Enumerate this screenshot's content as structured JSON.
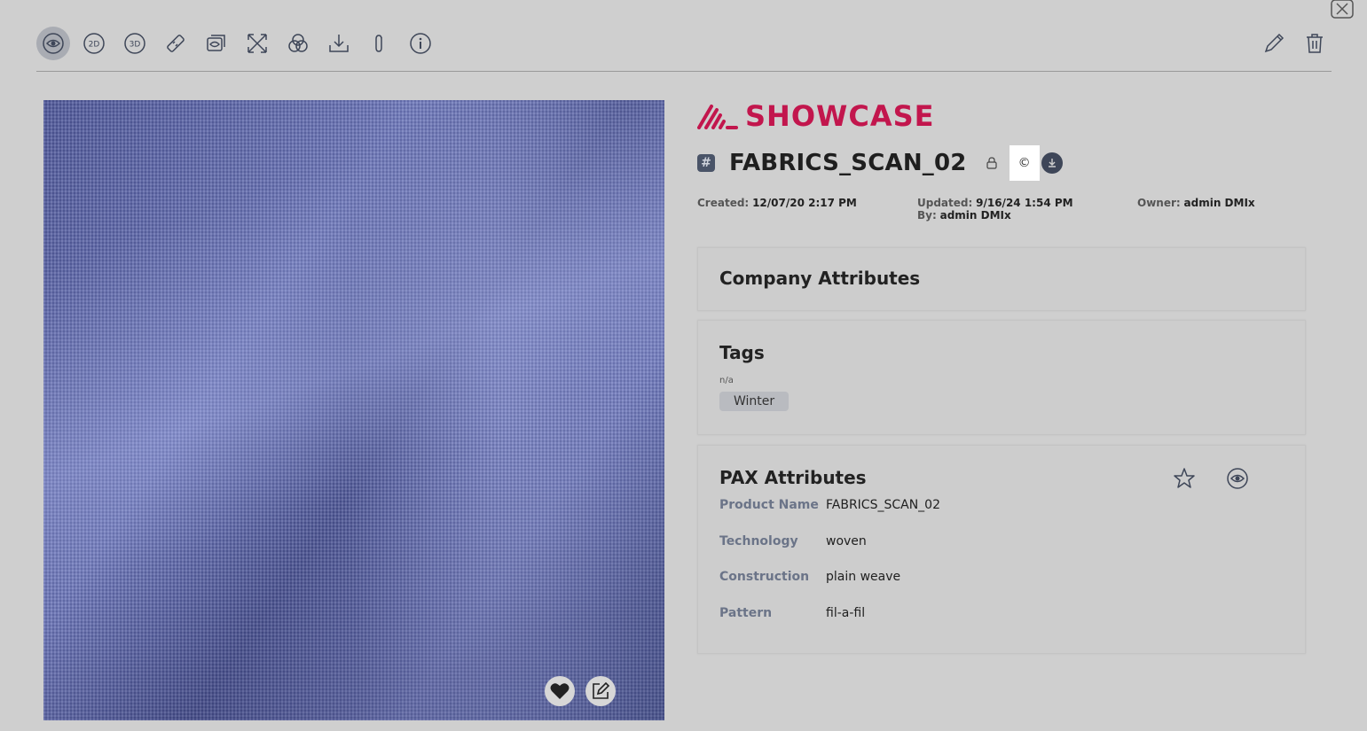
{
  "toolbar": {
    "items": [
      {
        "name": "view-icon"
      },
      {
        "name": "2d-icon",
        "label": "2D"
      },
      {
        "name": "3d-icon",
        "label": "3D"
      },
      {
        "name": "measure-icon"
      },
      {
        "name": "views-icon"
      },
      {
        "name": "expand-icon"
      },
      {
        "name": "color-icon"
      },
      {
        "name": "download-icon"
      },
      {
        "name": "attachment-icon"
      },
      {
        "name": "info-icon"
      }
    ],
    "right_items": [
      {
        "name": "edit-pencil-icon"
      },
      {
        "name": "delete-trash-icon"
      }
    ]
  },
  "brand": {
    "logo_text": "SHOWCASE",
    "color": "#c2164d"
  },
  "asset": {
    "title": "FABRICS_SCAN_02",
    "copyright_symbol": "©",
    "created_label": "Created:",
    "created_value": "12/07/20 2:17 PM",
    "updated_label": "Updated:",
    "updated_value": "9/16/24 1:54 PM",
    "by_label": "By:",
    "by_value": "admin DMIx",
    "owner_label": "Owner:",
    "owner_value": "admin DMIx"
  },
  "sections": {
    "company_attributes_title": "Company Attributes",
    "tags_title": "Tags",
    "tags_category": "n/a",
    "tags": [
      "Winter"
    ],
    "pax_title": "PAX Attributes",
    "pax_rows": [
      {
        "key": "Product Name",
        "value": "FABRICS_SCAN_02"
      },
      {
        "key": "Technology",
        "value": "woven"
      },
      {
        "key": "Construction",
        "value": "plain weave"
      },
      {
        "key": "Pattern",
        "value": "fil-a-fil"
      }
    ]
  },
  "colors": {
    "background": "#cfcfcf",
    "accent": "#c2164d",
    "icon": "#3e4658"
  }
}
